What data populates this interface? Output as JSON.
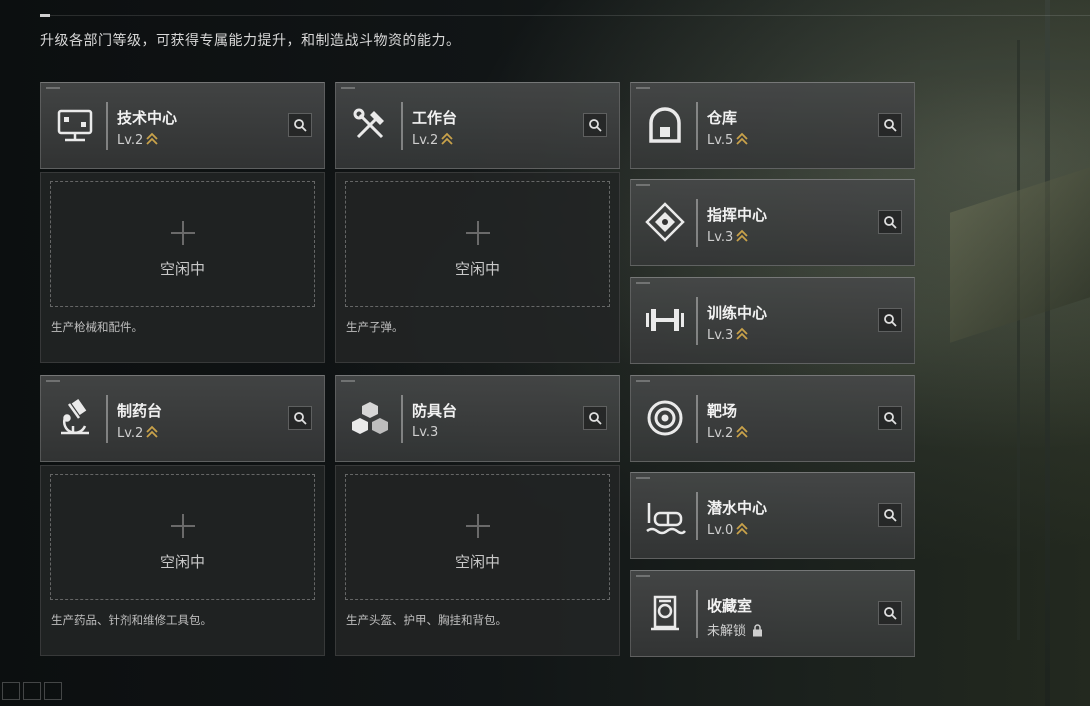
{
  "header": {
    "subtitle": "升级各部门等级，可获得专属能力提升，和制造战斗物资的能力。"
  },
  "accent_color": "#c9a24a",
  "departments": [
    {
      "id": "tech-center",
      "name": "技术中心",
      "level": "Lv.2",
      "upgradable": true,
      "icon": "monitor-icon"
    },
    {
      "id": "workbench",
      "name": "工作台",
      "level": "Lv.2",
      "upgradable": true,
      "icon": "tools-icon"
    },
    {
      "id": "warehouse",
      "name": "仓库",
      "level": "Lv.5",
      "upgradable": true,
      "icon": "warehouse-icon"
    },
    {
      "id": "command-center",
      "name": "指挥中心",
      "level": "Lv.3",
      "upgradable": true,
      "icon": "command-diamond-icon"
    },
    {
      "id": "training-center",
      "name": "训练中心",
      "level": "Lv.3",
      "upgradable": true,
      "icon": "dumbbell-icon"
    },
    {
      "id": "pharmacy",
      "name": "制药台",
      "level": "Lv.2",
      "upgradable": true,
      "icon": "microscope-icon"
    },
    {
      "id": "armor-bench",
      "name": "防具台",
      "level": "Lv.3",
      "upgradable": false,
      "icon": "cubes-icon"
    },
    {
      "id": "shooting-range",
      "name": "靶场",
      "level": "Lv.2",
      "upgradable": true,
      "icon": "target-icon"
    },
    {
      "id": "diving-center",
      "name": "潜水中心",
      "level": "Lv.0",
      "upgradable": true,
      "icon": "diving-mask-icon"
    },
    {
      "id": "collection-room",
      "name": "收藏室",
      "level": "未解锁",
      "locked": true,
      "icon": "collection-case-icon"
    }
  ],
  "production_slots": [
    {
      "status": "空闲中",
      "description": "生产枪械和配件。"
    },
    {
      "status": "空闲中",
      "description": "生产子弹。"
    },
    {
      "status": "空闲中",
      "description": "生产药品、针剂和维修工具包。"
    },
    {
      "status": "空闲中",
      "description": "生产头盔、护甲、胸挂和背包。"
    }
  ]
}
